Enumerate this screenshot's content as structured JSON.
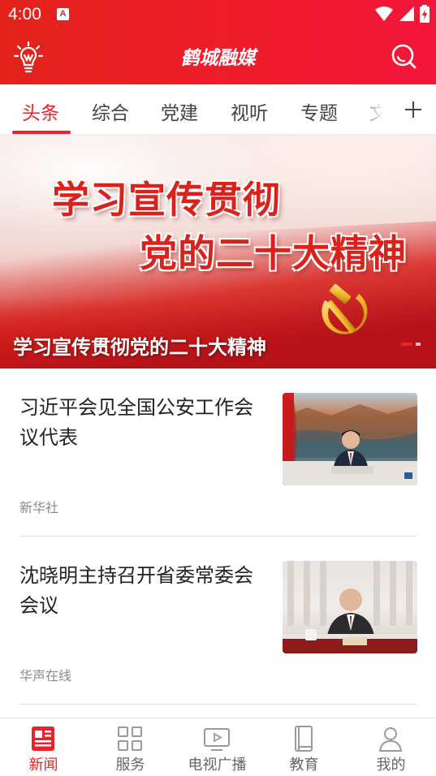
{
  "status_bar": {
    "time": "4:00",
    "notification_badge": "A"
  },
  "app_bar": {
    "title": "鹤城融媒",
    "left_icon": "lightbulb-icon",
    "right_icon": "search-icon"
  },
  "tabs": {
    "items": [
      {
        "label": "头条",
        "active": true
      },
      {
        "label": "综合"
      },
      {
        "label": "党建"
      },
      {
        "label": "视听"
      },
      {
        "label": "专题"
      },
      {
        "label": "文"
      }
    ],
    "add_icon": "plus-icon"
  },
  "banner": {
    "headline_line1": "学习宣传贯彻",
    "headline_line2": "党的二十大精神",
    "caption": "学习宣传贯彻党的二十大精神",
    "slide_count": 2,
    "active_slide": 1
  },
  "news": [
    {
      "title": "习近平会见全国公安工作会议代表",
      "source": "新华社"
    },
    {
      "title": "沈晓明主持召开省委常委会会议",
      "source": "华声在线"
    }
  ],
  "bottom_nav": {
    "items": [
      {
        "label": "新闻",
        "icon": "newspaper-icon",
        "active": true
      },
      {
        "label": "服务",
        "icon": "grid-icon"
      },
      {
        "label": "电视广播",
        "icon": "tv-icon"
      },
      {
        "label": "教育",
        "icon": "book-icon"
      },
      {
        "label": "我的",
        "icon": "user-icon"
      }
    ]
  },
  "colors": {
    "brand_red": "#e8232a",
    "header_start": "#e3231b",
    "header_end": "#f2163a"
  }
}
